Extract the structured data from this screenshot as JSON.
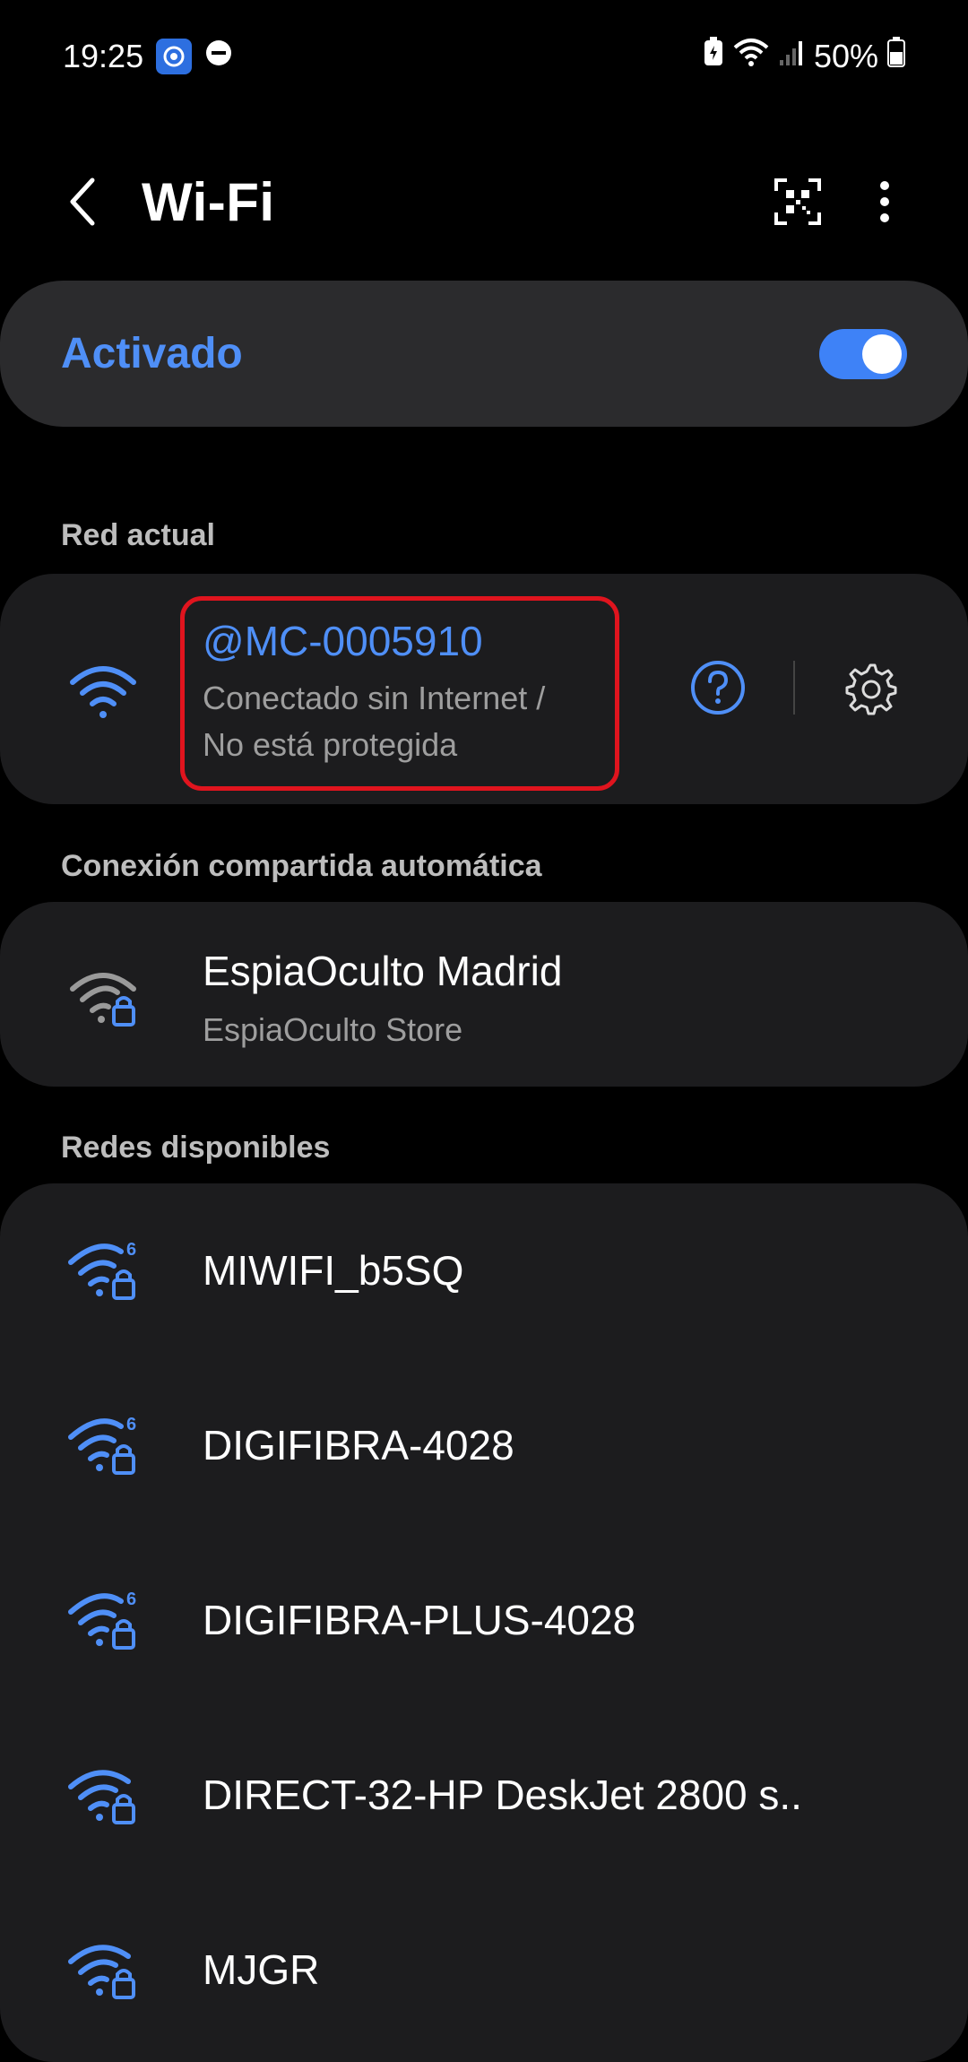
{
  "status_bar": {
    "time": "19:25",
    "battery": "50%",
    "icons": [
      "app-notification-icon",
      "do-not-disturb-icon",
      "battery-saver-icon",
      "wifi-status-icon",
      "cellular-signal-icon",
      "battery-icon"
    ]
  },
  "header": {
    "title": "Wi-Fi",
    "back_icon": "back-arrow-icon",
    "qr_icon": "qr-scan-icon",
    "more_icon": "more-options-icon"
  },
  "toggle": {
    "label": "Activado",
    "state": "on"
  },
  "current_network": {
    "section_label": "Red actual",
    "name": "@MC-0005910",
    "status_line1": "Conectado sin Internet /",
    "status_line2": "No está protegida"
  },
  "auto_hotspot": {
    "section_label": "Conexión compartida automática",
    "name": "EspiaOculto Madrid",
    "subtitle": "EspiaOculto Store"
  },
  "available": {
    "section_label": "Redes disponibles",
    "networks": [
      {
        "name": "MIWIFI_b5SQ",
        "wifi6": true
      },
      {
        "name": "DIGIFIBRA-4028",
        "wifi6": true
      },
      {
        "name": "DIGIFIBRA-PLUS-4028",
        "wifi6": true
      },
      {
        "name": "DIRECT-32-HP DeskJet 2800 s..",
        "wifi6": false
      },
      {
        "name": "MJGR",
        "wifi6": false
      }
    ]
  },
  "colors": {
    "accent": "#4f8ff7",
    "card_bg": "#1c1c1e",
    "toggle_card_bg": "#2b2b2d",
    "highlight": "#e0141e"
  }
}
